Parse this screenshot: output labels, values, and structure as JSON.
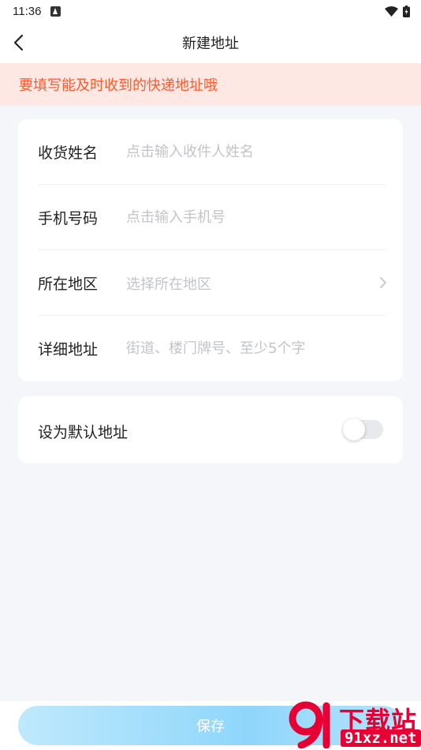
{
  "status_bar": {
    "time": "11:36"
  },
  "nav": {
    "title": "新建地址"
  },
  "notice": {
    "text": "要填写能及时收到的快递地址哦"
  },
  "form": {
    "rows": [
      {
        "label": "收货姓名",
        "placeholder": "点击输入收件人姓名"
      },
      {
        "label": "手机号码",
        "placeholder": "点击输入手机号"
      },
      {
        "label": "所在地区",
        "placeholder": "选择所在地区"
      },
      {
        "label": "详细地址",
        "placeholder": "街道、楼门牌号、至少5个字"
      }
    ]
  },
  "default_address": {
    "label": "设为默认地址",
    "enabled": false
  },
  "save_button": {
    "label": "保存"
  },
  "watermark": {
    "text_top": "下载站",
    "text_bottom": "91xz.net"
  },
  "colors": {
    "notice_bg": "#fde8e3",
    "notice_text": "#ff5a2c",
    "button_gradient_mid": "#8fd6fb",
    "watermark_red": "#e60033"
  }
}
